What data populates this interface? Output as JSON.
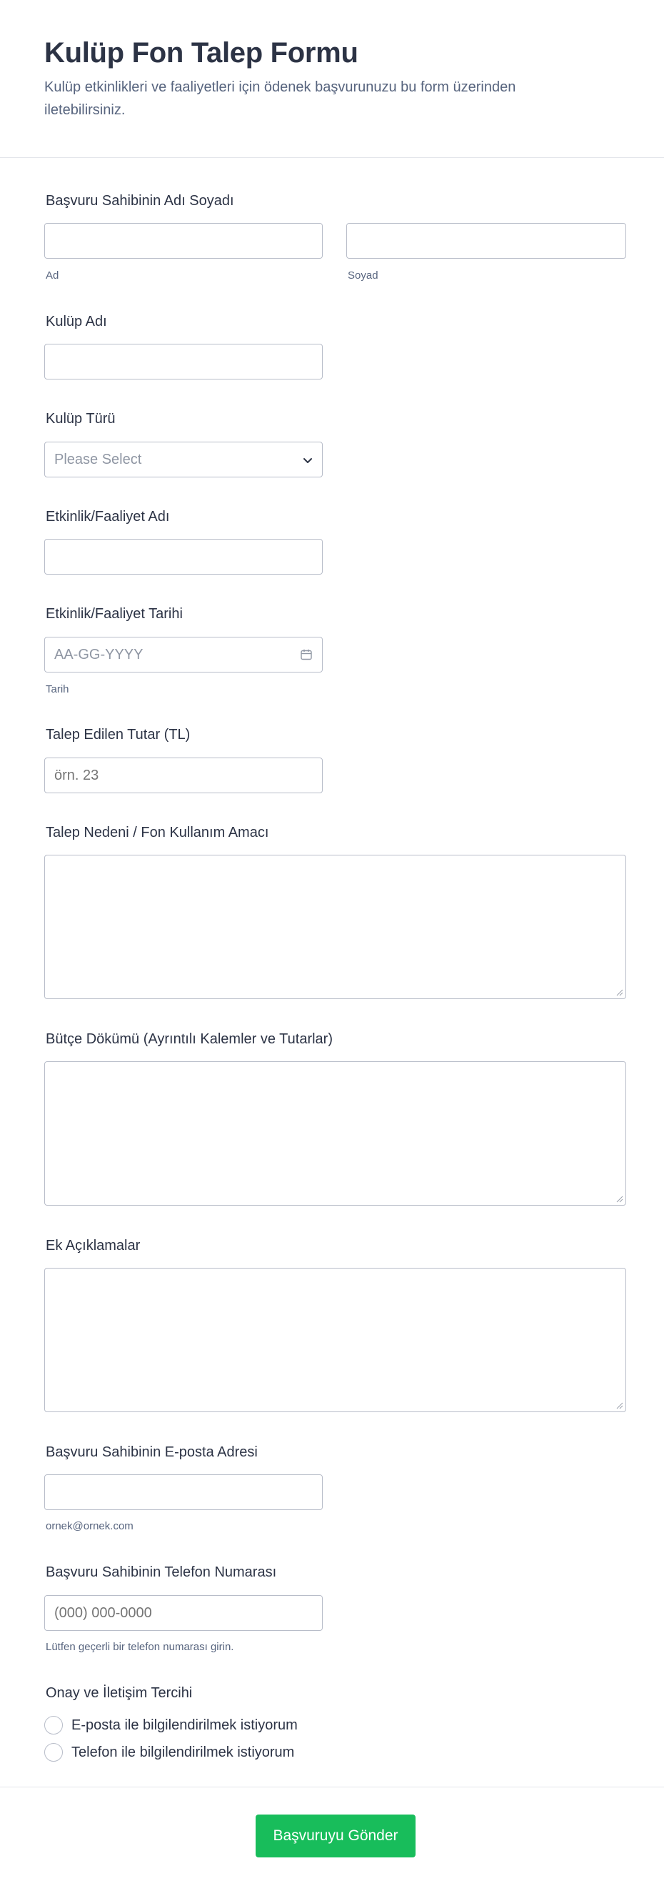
{
  "form": {
    "title": "Kulüp Fon Talep Formu",
    "subtitle": "Kulüp etkinlikleri ve faaliyetleri için ödenek başvurunuzu bu form üzerinden iletebilirsiniz."
  },
  "fields": {
    "name": {
      "label": "Başvuru Sahibinin Adı Soyadı",
      "first_sublabel": "Ad",
      "last_sublabel": "Soyad",
      "first_value": "",
      "last_value": ""
    },
    "club_name": {
      "label": "Kulüp Adı",
      "value": ""
    },
    "club_type": {
      "label": "Kulüp Türü",
      "selected": "Please Select"
    },
    "event_name": {
      "label": "Etkinlik/Faaliyet Adı",
      "value": ""
    },
    "event_date": {
      "label": "Etkinlik/Faaliyet Tarihi",
      "placeholder": "AA-GG-YYYY",
      "sublabel": "Tarih"
    },
    "amount": {
      "label": "Talep Edilen Tutar (TL)",
      "placeholder": "örn. 23"
    },
    "reason": {
      "label": "Talep Nedeni / Fon Kullanım Amacı",
      "value": ""
    },
    "budget": {
      "label": "Bütçe Dökümü (Ayrıntılı Kalemler ve Tutarlar)",
      "value": ""
    },
    "notes": {
      "label": "Ek Açıklamalar",
      "value": ""
    },
    "email": {
      "label": "Başvuru Sahibinin E-posta Adresi",
      "sublabel": "ornek@ornek.com",
      "value": ""
    },
    "phone": {
      "label": "Başvuru Sahibinin Telefon Numarası",
      "placeholder": "(000) 000-0000",
      "sublabel": "Lütfen geçerli bir telefon numarası girin."
    },
    "consent": {
      "label": "Onay ve İletişim Tercihi",
      "options": [
        "E-posta ile bilgilendirilmek istiyorum",
        "Telefon ile bilgilendirilmek istiyorum"
      ]
    }
  },
  "submit_label": "Başvuruyu Gönder",
  "colors": {
    "accent": "#18bd5b",
    "text": "#2c3345",
    "muted": "#57647e",
    "border": "#b8bdc9"
  },
  "icons": {
    "select": "chevron-down-icon",
    "date": "calendar-icon",
    "resize": "resize-grip-icon"
  }
}
